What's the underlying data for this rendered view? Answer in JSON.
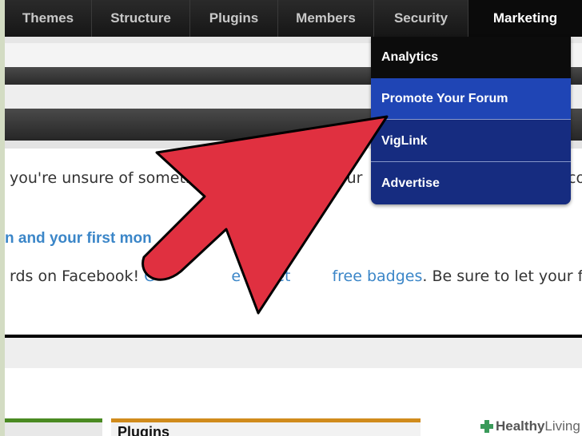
{
  "nav": {
    "items": [
      {
        "label": "Themes",
        "width": 103
      },
      {
        "label": "Structure",
        "width": 126
      },
      {
        "label": "Plugins",
        "width": 117
      },
      {
        "label": "Members",
        "width": 113
      },
      {
        "label": "Security",
        "width": 119
      },
      {
        "label": "Marketing",
        "width": 144
      }
    ],
    "active": "Marketing"
  },
  "dropdown": {
    "items": [
      "Analytics",
      "Promote Your Forum",
      "VigLink",
      "Advertise"
    ],
    "highlighted": "Promote Your Forum"
  },
  "content": {
    "line1_a": "you're unsure of someth",
    "line1_b": "our",
    "line1_c": "co",
    "heading_fragment_a": "n and your first mon",
    "line3_a": "rds on Facebook! ",
    "line3_link_a": "C",
    "line3_link_b": "e to get",
    "line3_link_c": "free badges",
    "line3_rest": ". Be sure to let your forum",
    "plugins_label": "Plugins"
  },
  "watermark": {
    "bold": "Healthy",
    "light": " Living"
  },
  "colors": {
    "nav_bg": "#1b1b1b",
    "dropdown_bg": "#13287a",
    "dropdown_highlight": "#1f45b5",
    "link": "#3b86c8",
    "arrow": "#e03040"
  }
}
